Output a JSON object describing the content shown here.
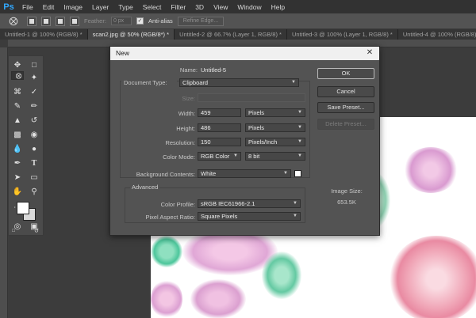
{
  "app": {
    "logo": "Ps"
  },
  "menu": [
    "File",
    "Edit",
    "Image",
    "Layer",
    "Type",
    "Select",
    "Filter",
    "3D",
    "View",
    "Window",
    "Help"
  ],
  "options_bar": {
    "feather_label": "Feather:",
    "feather_value": "0 px",
    "anti_alias_label": "Anti-alias",
    "refine_edge_label": "Refine Edge..."
  },
  "tabs": [
    {
      "label": "Untitled-1 @ 100% (RGB/8) *",
      "active": false
    },
    {
      "label": "scan2.jpg @ 50% (RGB/8*) *",
      "active": true
    },
    {
      "label": "Untitled-2 @ 66.7% (Layer 1, RGB/8) *",
      "active": false
    },
    {
      "label": "Untitled-3 @ 100% (Layer 1, RGB/8) *",
      "active": false
    },
    {
      "label": "Untitled-4 @ 100% (RGB/8)",
      "active": false
    }
  ],
  "dialog": {
    "title": "New",
    "name_label": "Name:",
    "name_value": "Untitled-5",
    "document_type_label": "Document Type:",
    "document_type_value": "Clipboard",
    "size_label": "Size:",
    "width_label": "Width:",
    "width_value": "459",
    "width_unit": "Pixels",
    "height_label": "Height:",
    "height_value": "486",
    "height_unit": "Pixels",
    "resolution_label": "Resolution:",
    "resolution_value": "150",
    "resolution_unit": "Pixels/Inch",
    "color_mode_label": "Color Mode:",
    "color_mode_value": "RGB Color",
    "bit_depth_value": "8 bit",
    "background_label": "Background Contents:",
    "background_value": "White",
    "advanced_label": "Advanced",
    "color_profile_label": "Color Profile:",
    "color_profile_value": "sRGB IEC61966-2.1",
    "pixel_aspect_label": "Pixel Aspect Ratio:",
    "pixel_aspect_value": "Square Pixels",
    "ok_label": "OK",
    "cancel_label": "Cancel",
    "save_preset_label": "Save Preset...",
    "delete_preset_label": "Delete Preset...",
    "image_size_label": "Image Size:",
    "image_size_value": "653.5K"
  },
  "colors": {
    "accent": "#31a8ff",
    "dialog_bg": "#535353",
    "canvas_bg": "#ffffff"
  }
}
